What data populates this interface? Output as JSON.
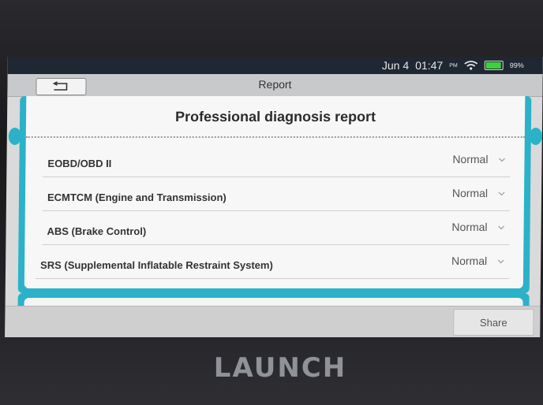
{
  "status_bar": {
    "date": "Jun 4",
    "time": "01:47",
    "ampm": "PM",
    "battery_pct": "99%"
  },
  "header": {
    "title": "Report"
  },
  "report": {
    "title": "Professional diagnosis report",
    "systems": [
      {
        "name": "EOBD/OBD II",
        "status": "Normal"
      },
      {
        "name": "ECMTCM (Engine and Transmission)",
        "status": "Normal"
      },
      {
        "name": "ABS (Brake Control)",
        "status": "Normal"
      },
      {
        "name": "SRS (Supplemental Inflatable Restraint System)",
        "status": "Normal"
      }
    ]
  },
  "footer": {
    "share_label": "Share"
  },
  "device": {
    "brand_logo": "LAUNCH"
  },
  "colors": {
    "accent": "#2bb2c8",
    "battery": "#3dd23d"
  }
}
